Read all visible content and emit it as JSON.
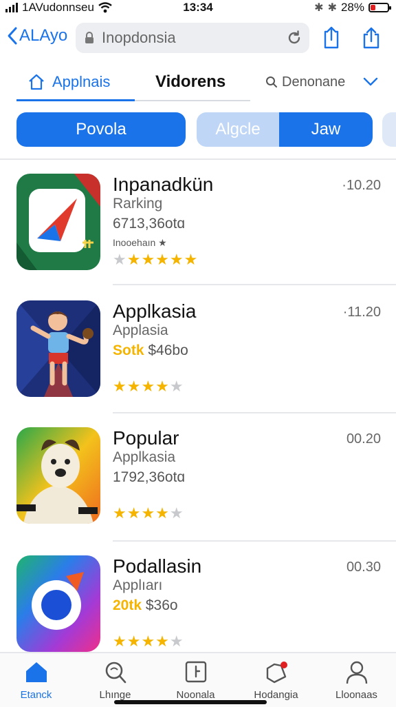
{
  "status": {
    "carrier": "1AVudonnseu",
    "time": "13:34",
    "battery": "28%",
    "battery_level": 0.28
  },
  "nav": {
    "back_label": "ALAyo",
    "url": "Inopdonsia"
  },
  "tabs": [
    {
      "label": "Applnais",
      "active": true
    },
    {
      "label": "Vidorens",
      "active": false
    },
    {
      "label": "Denonane",
      "active": false
    }
  ],
  "pills": {
    "first": "Povola",
    "seg_a": "Algcle",
    "seg_b": "Jaw"
  },
  "apps": [
    {
      "title": "Inpanadkün",
      "sub": "Rarking",
      "meta_plain": "6713,36otɑ",
      "small": "Inooehaın ★",
      "price": "·10.20",
      "rating": 5
    },
    {
      "title": "Applkasia",
      "sub": "Applasia",
      "meta_hl": "Sotk",
      "meta_plain": "$46bo",
      "price": "·11.20",
      "rating": 4
    },
    {
      "title": "Popular",
      "sub": "Applkasia",
      "meta_plain": "1792,36otɑ",
      "price": "00.20",
      "rating": 4
    },
    {
      "title": "Podallasin",
      "sub": "Applıarı",
      "meta_hl": "20tk",
      "meta_plain": "$36o",
      "price": "00.30",
      "rating": 4
    }
  ],
  "bottom_tabs": [
    {
      "label": "Etanck",
      "icon": "home-icon",
      "active": true
    },
    {
      "label": "Lhınge",
      "icon": "search-icon",
      "active": false
    },
    {
      "label": "Noonala",
      "icon": "apps-icon",
      "active": false
    },
    {
      "label": "Hodangia",
      "icon": "bell-icon",
      "active": false
    },
    {
      "label": "Lloonaas",
      "icon": "profile-icon",
      "active": false
    }
  ],
  "colors": {
    "accent": "#1a73e8",
    "star": "#f4b400",
    "battery_low": "#e02020"
  }
}
